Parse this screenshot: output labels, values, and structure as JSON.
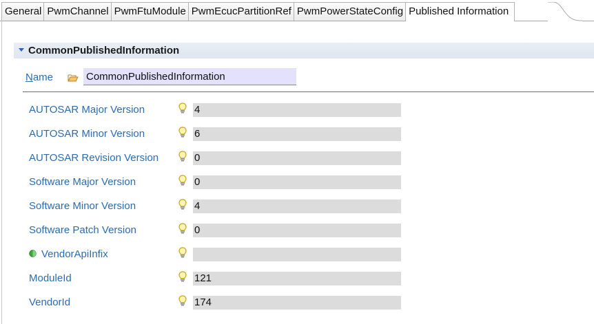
{
  "tabs": [
    {
      "label": "General",
      "active": false
    },
    {
      "label": "PwmChannel",
      "active": false
    },
    {
      "label": "PwmFtuModule",
      "active": false
    },
    {
      "label": "PwmEcucPartitionRef",
      "active": false
    },
    {
      "label": "PwmPowerStateConfig",
      "active": false
    },
    {
      "label": "Published Information",
      "active": true
    }
  ],
  "section": {
    "title": "CommonPublishedInformation"
  },
  "name_row": {
    "label_mnemonic": "N",
    "label_rest": "ame",
    "value": "CommonPublishedInformation"
  },
  "rows": [
    {
      "label": "AUTOSAR Major Version",
      "value": "4"
    },
    {
      "label": "AUTOSAR Minor Version",
      "value": "6"
    },
    {
      "label": "AUTOSAR Revision Version",
      "value": "0"
    },
    {
      "label": "Software Major Version",
      "value": "0"
    },
    {
      "label": "Software Minor Version",
      "value": "4"
    },
    {
      "label": "Software Patch Version",
      "value": "0"
    },
    {
      "label": "VendorApiInfix",
      "value": ""
    },
    {
      "label": "ModuleId",
      "value": "121"
    },
    {
      "label": "VendorId",
      "value": "174"
    }
  ],
  "icons": {
    "hint": "lightbulb-icon",
    "folder": "folder-open-icon",
    "status": "green-status-icon",
    "collapse": "triangle-down-icon"
  },
  "colors": {
    "label_blue": "#2b6cb0",
    "field_gray": "#dcdcdc",
    "name_field": "#e3e1fb",
    "header_bg": "#e4eaf2"
  }
}
